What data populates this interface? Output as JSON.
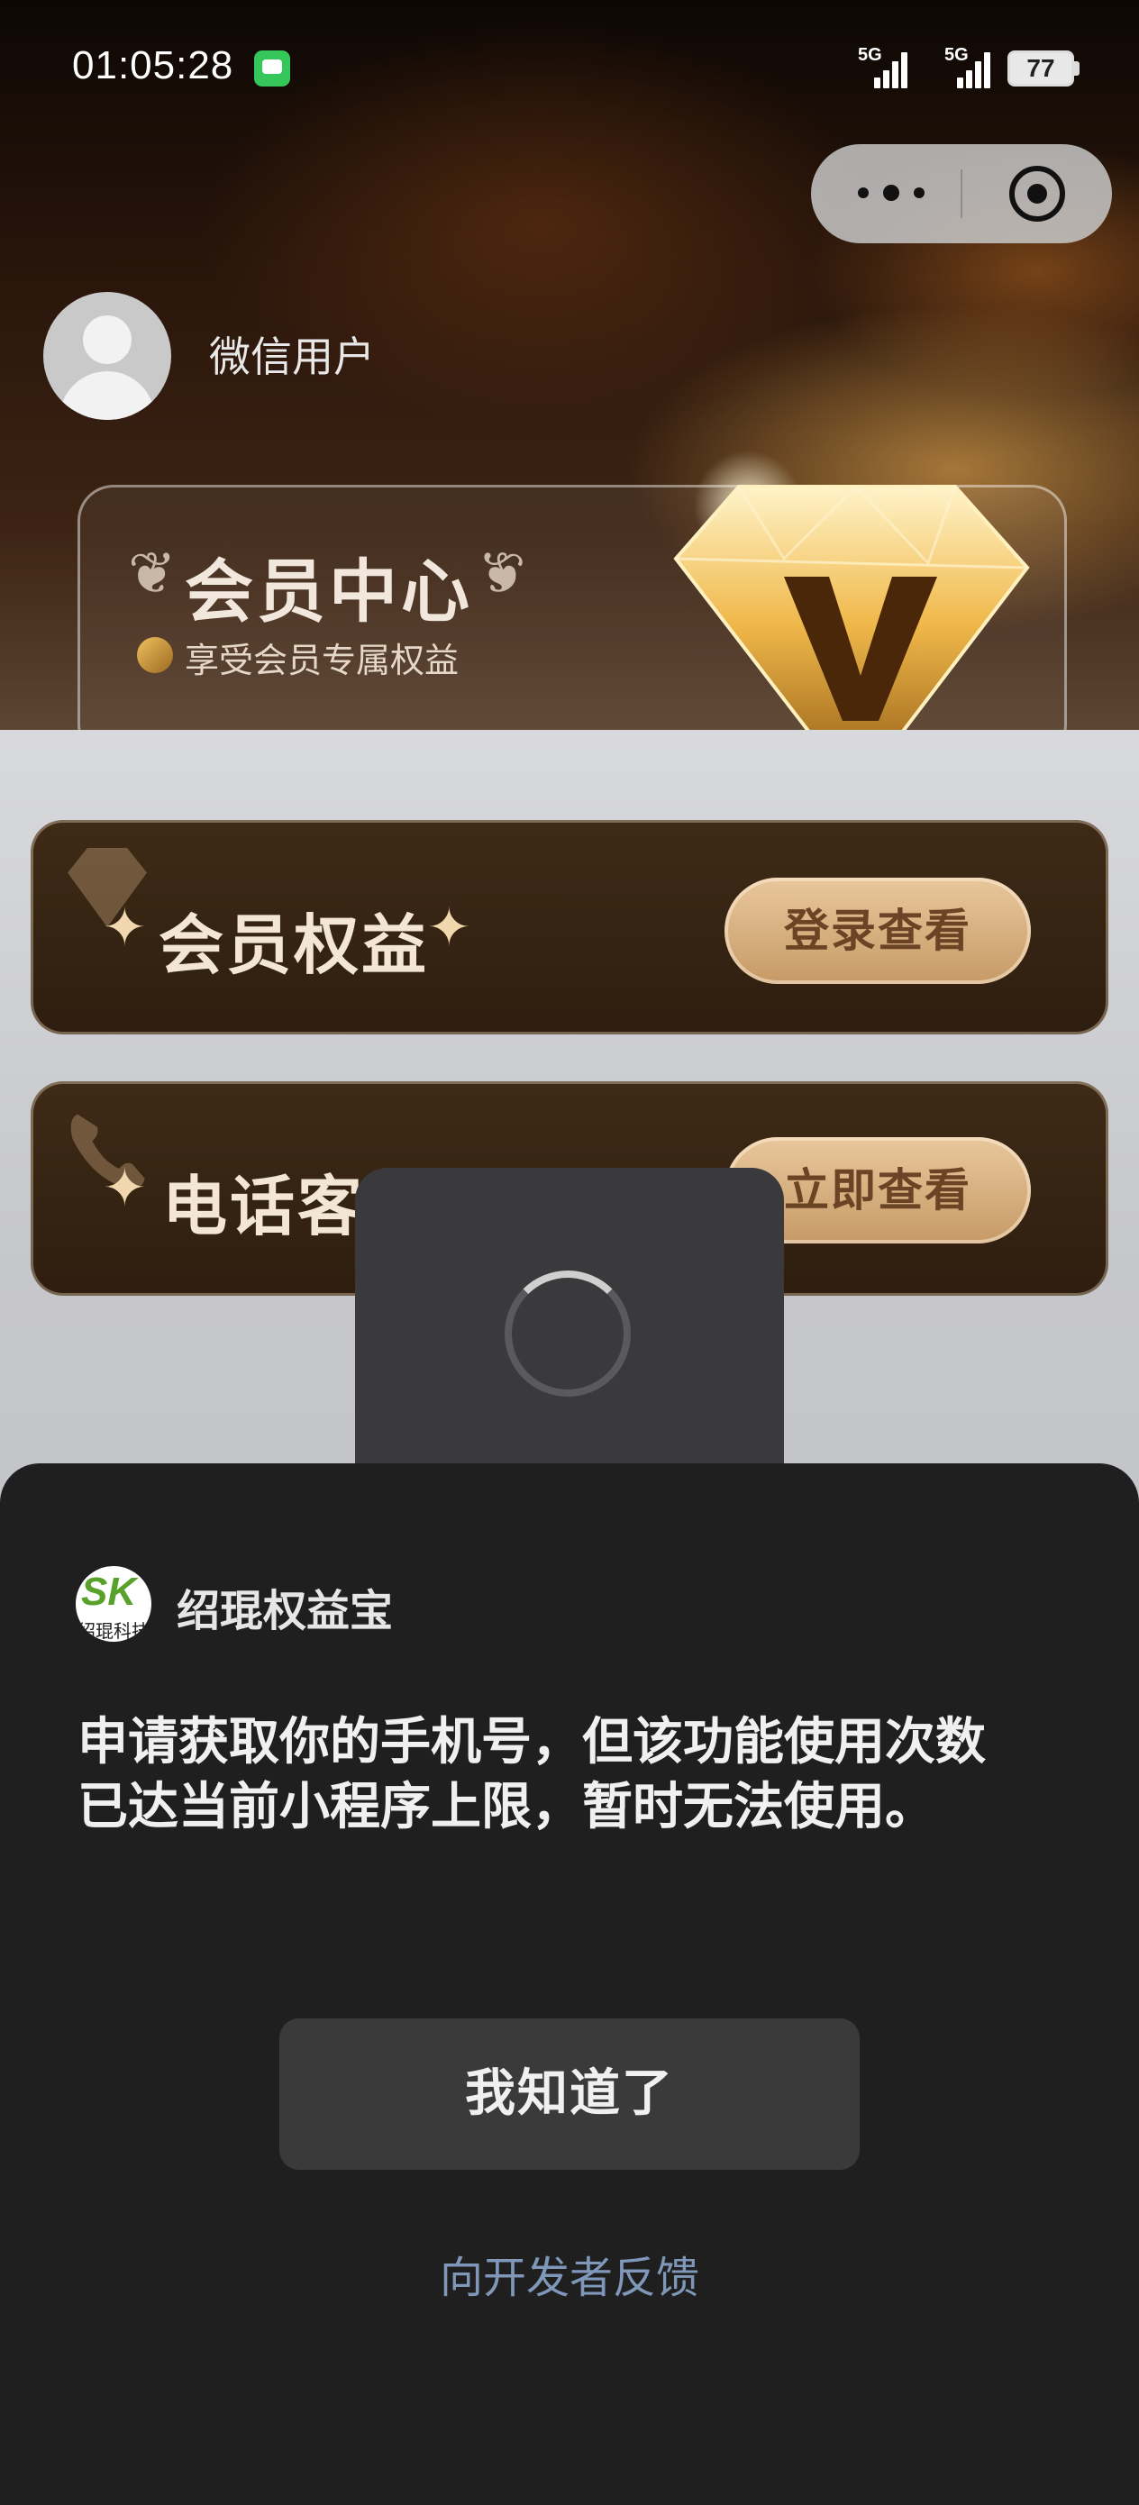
{
  "status_bar": {
    "time": "01:05:28",
    "signal_1_label": "5G",
    "signal_2_label": "5G",
    "battery": "77"
  },
  "user": {
    "name": "微信用户"
  },
  "member_center": {
    "title": "会员中心",
    "subtitle": "享受会员专属权益"
  },
  "cards": [
    {
      "label": "会员权益",
      "button": "登录查看"
    },
    {
      "label": "电话客",
      "button": "立即查看"
    }
  ],
  "dialog": {
    "app_name": "绍琨权益宝",
    "logo_text": "SK",
    "logo_caption": "绍琨科技",
    "message_line1": "申请获取你的手机号，但该功能使用次数",
    "message_line2": "已达当前小程序上限，暂时无法使用。",
    "ok_button": "我知道了",
    "feedback_link": "向开发者反馈"
  }
}
